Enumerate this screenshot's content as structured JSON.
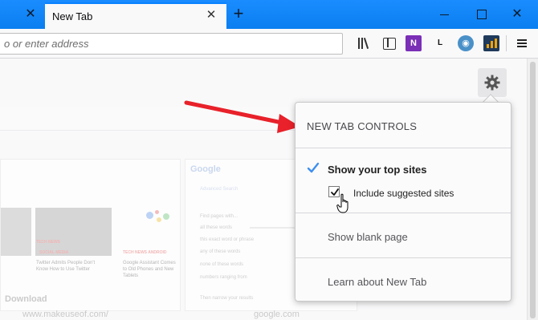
{
  "tabs": [
    {
      "label": "New Tab",
      "active": true
    }
  ],
  "urlbar": {
    "placeholder": "o or enter address"
  },
  "toolbar_icons": [
    "library-icon",
    "sidebar-icon",
    "onenote-icon",
    "l-extension-icon",
    "wave-extension-icon",
    "stats-extension-icon",
    "menu-icon"
  ],
  "toolbar": {
    "onenote_letter": "N",
    "l_letter": "L"
  },
  "colors": {
    "accent": "#0a84ff",
    "checkmark": "#3d8ff0",
    "arrow": "#e8212a"
  },
  "panel": {
    "title": "NEW TAB CONTROLS",
    "show_top_sites": "Show your top sites",
    "include_suggested": "Include suggested sites",
    "show_blank": "Show blank page",
    "learn_about": "Learn about New Tab",
    "show_top_sites_checked": true,
    "include_suggested_checked": true
  },
  "background": {
    "download_label": "Download",
    "url_left": "www.makeuseof.com/",
    "url_google": "google.com",
    "google_logo": "Google",
    "google_sub": "Advanced Search",
    "google_field": "Find pages with...",
    "google_field2": "all these words",
    "google_field3": "this exact word or phrase",
    "google_field4": "any of these words",
    "google_field5": "none of these words",
    "google_field6": "numbers ranging from",
    "google_field7": "Then narrow your results",
    "tile1_tag": "TECH NEWS",
    "tile1_tag2": "SOCIAL MEDIA",
    "tile1_caption": "Twitter Admits People Don't Know How to Use Twitter",
    "tile2_tag": "TECH NEWS ANDROID",
    "tile2_caption": "Google Assistant Comes to Old Phones and New Tablets"
  }
}
